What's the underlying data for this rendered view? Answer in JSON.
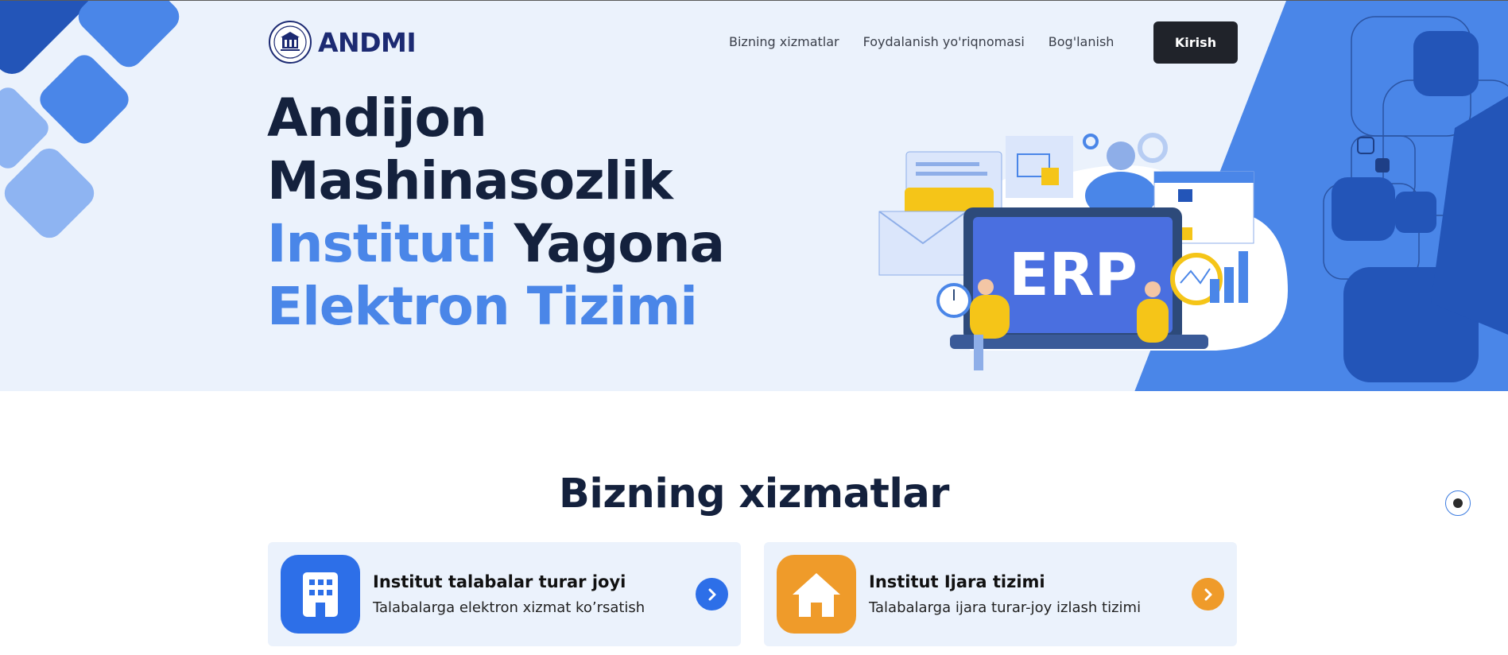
{
  "brand": {
    "name": "ANDMI",
    "logo_icon": "institute-emblem-icon"
  },
  "nav": {
    "items": [
      "Bizning xizmatlar",
      "Foydalanish yo'riqnomasi",
      "Bog'lanish"
    ],
    "login_label": "Kirish"
  },
  "hero": {
    "line1": "Andijon",
    "line2": "Mashinasozlik",
    "line3_accent": "Instituti",
    "line3_dark": " Yagona",
    "line4_accent": "Elektron Tizimi",
    "illustration_label": "ERP"
  },
  "services": {
    "title": "Bizning xizmatlar",
    "cards": [
      {
        "title": "Institut talabalar turar joyi",
        "subtitle": "Talabalarga elektron xizmat ko’rsatish",
        "icon": "building-icon",
        "color": "#2d6fe8"
      },
      {
        "title": "Institut Ijara tizimi",
        "subtitle": "Talabalarga ijara turar-joy izlash tizimi",
        "icon": "house-icon",
        "color": "#ef9b2a"
      }
    ]
  },
  "colors": {
    "accent": "#4a86e8",
    "dark": "#14213d",
    "hero_bg": "#ebf2fc",
    "panel_blue": "#4a86e8"
  }
}
